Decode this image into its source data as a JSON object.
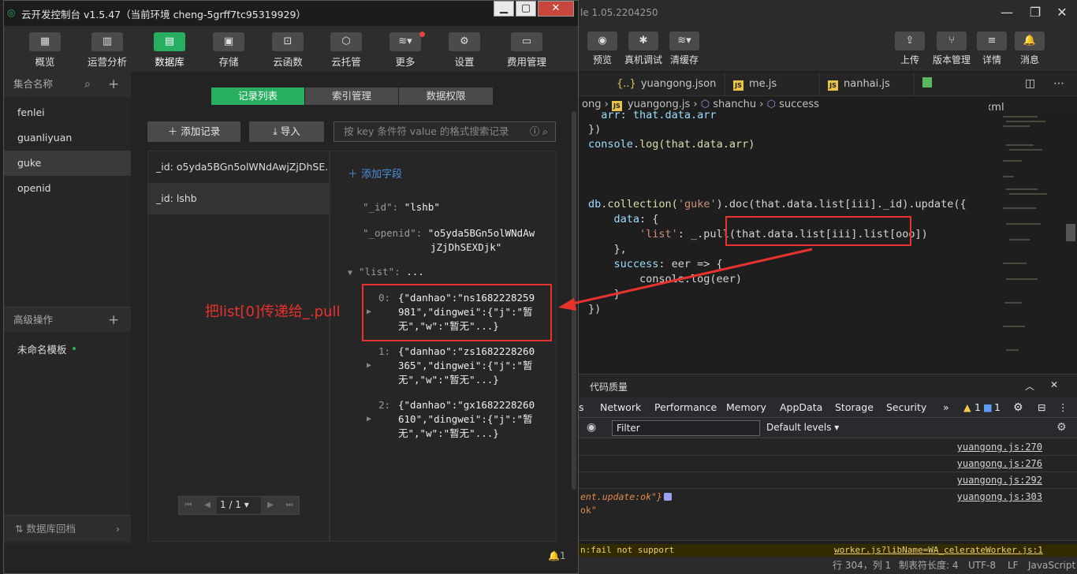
{
  "ide": {
    "title_suffix": "le 1.05.2204250",
    "toolbar": [
      {
        "label": "预览",
        "icon": "eye-icon",
        "glyph": "◉"
      },
      {
        "label": "真机调试",
        "icon": "bug-icon",
        "glyph": "✱"
      },
      {
        "label": "清缓存",
        "icon": "layers-icon",
        "glyph": "≋▾"
      },
      {
        "label": "上传",
        "icon": "upload-icon",
        "glyph": "⇪"
      },
      {
        "label": "版本管理",
        "icon": "branch-icon",
        "glyph": "⑂"
      },
      {
        "label": "详情",
        "icon": "menu-icon",
        "glyph": "≡"
      },
      {
        "label": "消息",
        "icon": "bell-icon",
        "glyph": "🔔"
      }
    ],
    "tabs": [
      "yuangong.json",
      "me.js",
      "nanhai.js",
      "yuangong.wxml"
    ],
    "breadcrumb": {
      "part1": "ong",
      "part2": "yuangong.js",
      "part3": "shanchu",
      "part4": "success"
    },
    "code": {
      "l1": "  arr: that.data.arr",
      "l2": "})",
      "l3a": "console",
      "l3b": ".log(that.data.arr)",
      "l6a": "db",
      "l6b": ".collection(",
      "l6c": "'guke'",
      "l6d": ").doc(that.data.list[iii]._id).update({",
      "l7a": "    data",
      "l7b": ": {",
      "l8a": "        'list'",
      "l8b": ": _.pull(that.data.list[iii].list[ooo])",
      "l9": "    },",
      "l10a": "    success",
      "l10b": ": eer => {",
      "l11": "        console.log(eer)",
      "l12": "    }",
      "l13": "})"
    },
    "devtools": {
      "panel_title": "代码质量",
      "tabs": [
        "s",
        "Network",
        "Performance",
        "Memory",
        "AppData",
        "Storage",
        "Security",
        "»"
      ],
      "warn_count": "1",
      "info_count": "1",
      "filter_placeholder": "Filter",
      "levels": "Default levels ▾",
      "logs": [
        {
          "text": "",
          "link": "yuangong.js:270"
        },
        {
          "text": "",
          "link": "yuangong.js:276"
        },
        {
          "text": "",
          "link": "yuangong.js:292"
        },
        {
          "text": "ent.update:ok\"}",
          "link": "yuangong.js:303"
        }
      ],
      "log_cont": "ok\"",
      "warn_line": "n:fail not support",
      "warn_link": "worker.js?libName=WA_celerateWorker.js:1"
    },
    "status": {
      "pos": "行 304，列 1",
      "tab": "制表符长度: 4",
      "enc": "UTF-8",
      "eol": "LF",
      "lang": "JavaScript"
    }
  },
  "console": {
    "title": "云开发控制台 v1.5.47（当前环境 cheng-5grff7tc95319929）",
    "toolbar": [
      {
        "label": "概览",
        "icon": "grid-icon",
        "glyph": "▦"
      },
      {
        "label": "运营分析",
        "icon": "chart-icon",
        "glyph": "▥"
      },
      {
        "label": "数据库",
        "icon": "database-icon",
        "glyph": "▤"
      },
      {
        "label": "存储",
        "icon": "storage-icon",
        "glyph": "▣"
      },
      {
        "label": "云函数",
        "icon": "function-icon",
        "glyph": "⊡"
      },
      {
        "label": "云托管",
        "icon": "cube-icon",
        "glyph": "⬡"
      },
      {
        "label": "更多",
        "icon": "layers-icon",
        "glyph": "≋▾"
      },
      {
        "label": "设置",
        "icon": "gear-icon",
        "glyph": "⚙"
      },
      {
        "label": "费用管理",
        "icon": "billing-icon",
        "glyph": "▭"
      }
    ],
    "sidebar": {
      "header": "集合名称",
      "collections": [
        "fenlei",
        "guanliyuan",
        "guke",
        "openid"
      ],
      "advanced_header": "高级操作",
      "advanced_item": "未命名模板",
      "footer": "数据库回档"
    },
    "segments": [
      "记录列表",
      "索引管理",
      "数据权限"
    ],
    "actions": {
      "add": "添加记录",
      "import": "导入"
    },
    "search_placeholder": "按 key 条件符 value 的格式搜索记录",
    "records": [
      "_id: o5yda5BGn5olWNdAwjZjDhSE...",
      "_id: lshb"
    ],
    "detail": {
      "add_field": "添加字段",
      "id_key": "\"_id\":",
      "id_val": "\"lshb\"",
      "openid_key": "\"_openid\":",
      "openid_val1": "\"o5yda5BGn5olWNdAw",
      "openid_val2": "jZjDhSEXDjk\"",
      "list_key": "\"list\":",
      "list_ellipsis": "...",
      "items": [
        {
          "idx": "0:",
          "l1": "{\"danhao\":\"ns1682228259",
          "l2": "981\",\"dingwei\":{\"j\":\"暂",
          "l3": "无\",\"w\":\"暂无\"...}"
        },
        {
          "idx": "1:",
          "l1": "{\"danhao\":\"zs1682228260",
          "l2": "365\",\"dingwei\":{\"j\":\"暂",
          "l3": "无\",\"w\":\"暂无\"...}"
        },
        {
          "idx": "2:",
          "l1": "{\"danhao\":\"gx1682228260",
          "l2": "610\",\"dingwei\":{\"j\":\"暂",
          "l3": "无\",\"w\":\"暂无\"...}"
        }
      ]
    },
    "pager": "1 / 1 ▾",
    "bell_count": "1",
    "annotation": "把list[0]传递给_.pull"
  },
  "colors": {
    "accent": "#27ae60",
    "annotation": "#e8322e"
  }
}
